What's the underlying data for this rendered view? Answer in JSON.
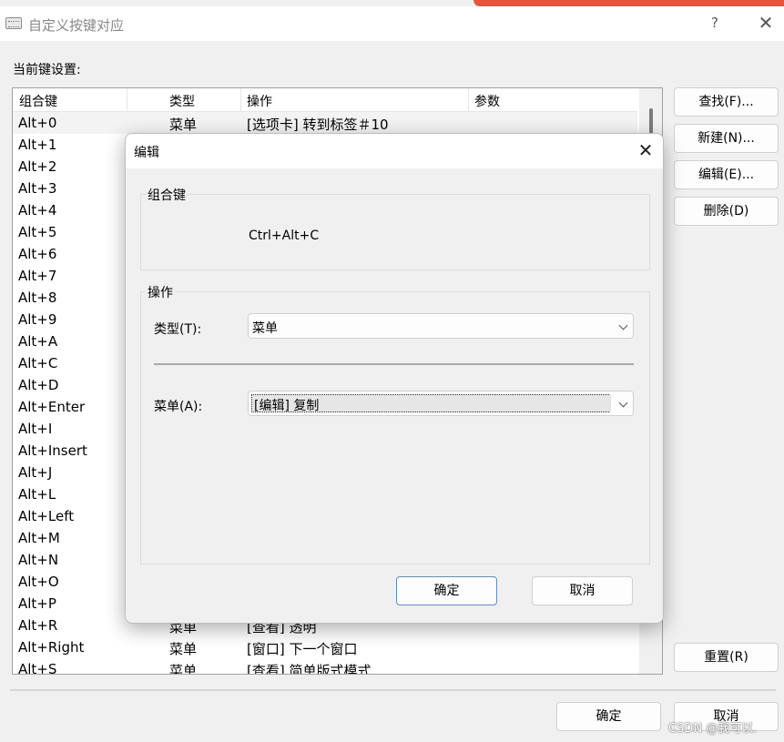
{
  "window": {
    "title": "自定义按键对应",
    "help_label": "?",
    "close_label": "✕"
  },
  "current_label": "当前键设置:",
  "list": {
    "headers": [
      "组合键",
      "类型",
      "操作",
      "参数"
    ],
    "rows": [
      {
        "key": "Alt+0",
        "type": "菜单",
        "op": "[选项卡] 转到标签＃10"
      },
      {
        "key": "Alt+1",
        "type": "",
        "op": ""
      },
      {
        "key": "Alt+2",
        "type": "",
        "op": ""
      },
      {
        "key": "Alt+3",
        "type": "",
        "op": ""
      },
      {
        "key": "Alt+4",
        "type": "",
        "op": ""
      },
      {
        "key": "Alt+5",
        "type": "",
        "op": ""
      },
      {
        "key": "Alt+6",
        "type": "",
        "op": ""
      },
      {
        "key": "Alt+7",
        "type": "",
        "op": ""
      },
      {
        "key": "Alt+8",
        "type": "",
        "op": ""
      },
      {
        "key": "Alt+9",
        "type": "",
        "op": ""
      },
      {
        "key": "Alt+A",
        "type": "",
        "op": ""
      },
      {
        "key": "Alt+C",
        "type": "",
        "op": ""
      },
      {
        "key": "Alt+D",
        "type": "",
        "op": ""
      },
      {
        "key": "Alt+Enter",
        "type": "",
        "op": ""
      },
      {
        "key": "Alt+I",
        "type": "",
        "op": ""
      },
      {
        "key": "Alt+Insert",
        "type": "",
        "op": ""
      },
      {
        "key": "Alt+J",
        "type": "",
        "op": ""
      },
      {
        "key": "Alt+L",
        "type": "",
        "op": ""
      },
      {
        "key": "Alt+Left",
        "type": "",
        "op": ""
      },
      {
        "key": "Alt+M",
        "type": "",
        "op": ""
      },
      {
        "key": "Alt+N",
        "type": "",
        "op": ""
      },
      {
        "key": "Alt+O",
        "type": "",
        "op": ""
      },
      {
        "key": "Alt+P",
        "type": "",
        "op": ""
      },
      {
        "key": "Alt+R",
        "type": "菜单",
        "op": "[查看] 透明"
      },
      {
        "key": "Alt+Right",
        "type": "菜单",
        "op": "[窗口] 下一个窗口"
      },
      {
        "key": "Alt+S",
        "type": "菜单",
        "op": "[查看] 简单版式模式"
      }
    ]
  },
  "side_buttons": {
    "find": "查找(F)...",
    "new": "新建(N)...",
    "edit": "编辑(E)...",
    "delete": "删除(D)",
    "reset": "重置(R)"
  },
  "footer": {
    "ok": "确定",
    "cancel": "取消"
  },
  "dialog": {
    "title": "编辑",
    "close_label": "✕",
    "combo_group_label": "组合键",
    "combo_value": "Ctrl+Alt+C",
    "op_group_label": "操作",
    "type_label": "类型(T):",
    "type_value": "菜单",
    "menu_label": "菜单(A):",
    "menu_value": "[编辑] 复制",
    "ok": "确定",
    "cancel": "取消"
  },
  "watermark": "CSDN @我可以."
}
